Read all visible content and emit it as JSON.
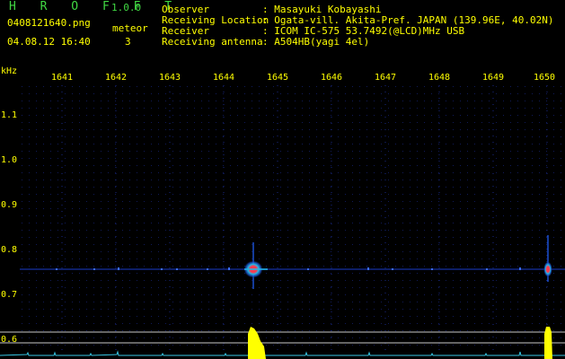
{
  "header": {
    "app_title": "H R O F F T",
    "app_version": "1.0.0",
    "filename": "0408121640.png",
    "datetime": "04.08.12 16:40",
    "meteor_label": "meteor",
    "meteor_count": "3"
  },
  "info": {
    "observer_label": "Observer",
    "observer_value": ": Masayuki Kobayashi",
    "location_label": "Receiving Location",
    "location_value": ": Ogata-vill. Akita-Pref. JAPAN (139.96E, 40.02N)",
    "receiver_label": "Receiver",
    "receiver_value": ": ICOM IC-575 53.7492(@LCD)MHz USB",
    "antenna_label": "Receiving antenna",
    "antenna_value": ": A504HB(yagi 4el)"
  },
  "axes": {
    "y_unit": "kHz",
    "x_ticks": [
      "1641",
      "1642",
      "1643",
      "1644",
      "1645",
      "1646",
      "1647",
      "1648",
      "1649",
      "1650"
    ],
    "y_ticks": [
      "1.1",
      "1.0",
      "0.9",
      "0.8",
      "0.7",
      "0.6"
    ]
  },
  "colors": {
    "label_yellow": "#ffff00",
    "title_green": "#41d843",
    "grid_blue": "#1a2a8a",
    "signal_line": "#3b6cf0",
    "meteor_core": "#ff3b4f",
    "meteor_halo": "#22b8e6",
    "count_yellow": "#ffff00",
    "baseline_cyan": "#37c8e6",
    "threshold_line": "#c8c8c8"
  }
}
